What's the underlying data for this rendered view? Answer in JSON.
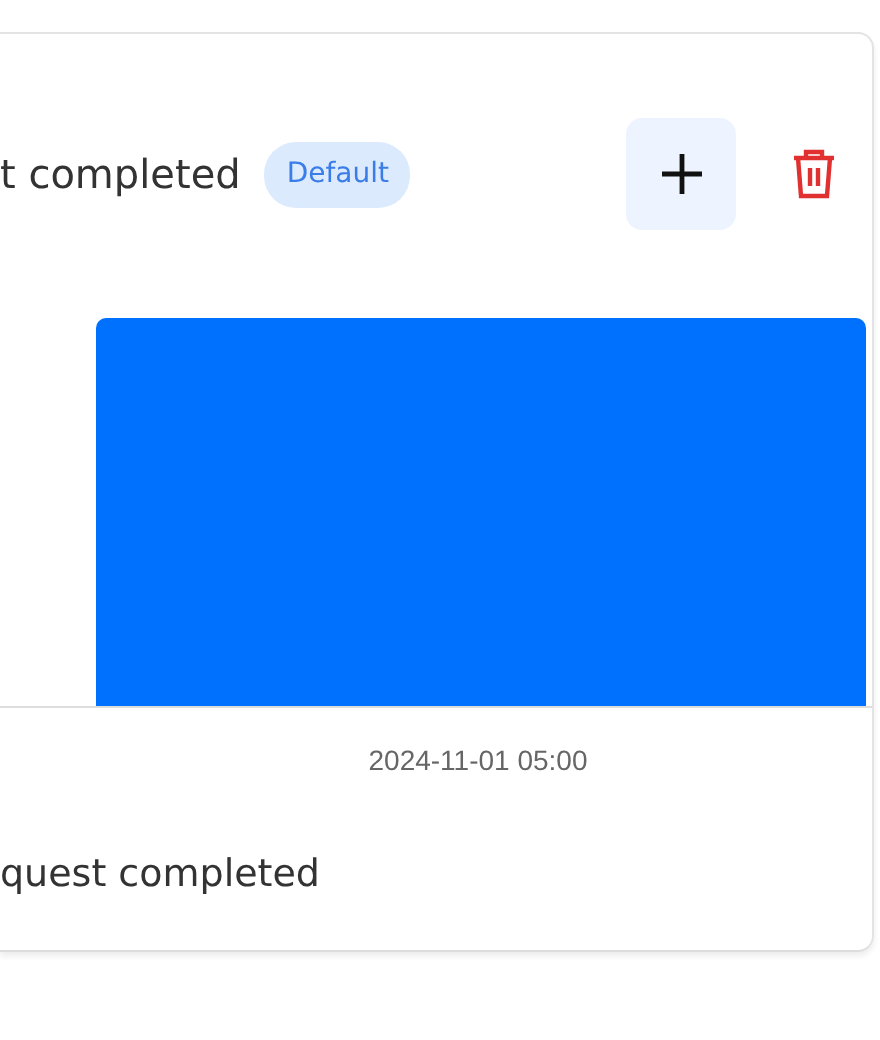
{
  "card": {
    "title": "t completed",
    "badge": "Default",
    "chart": {
      "x_label": "2024-11-01 05:00"
    },
    "legend": "quest completed"
  }
}
